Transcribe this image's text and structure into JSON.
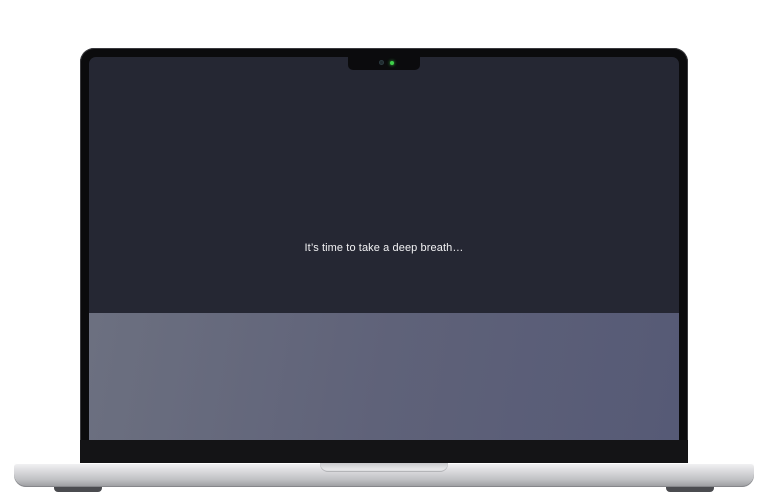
{
  "screen": {
    "message": "It’s time to take a deep breath…",
    "background_color": "#252733",
    "lower_panel_colors": [
      "#6c7080",
      "#565a76"
    ]
  },
  "device": {
    "camera_indicator_color": "#3fd14a",
    "body_color": "#d9d9dc"
  }
}
